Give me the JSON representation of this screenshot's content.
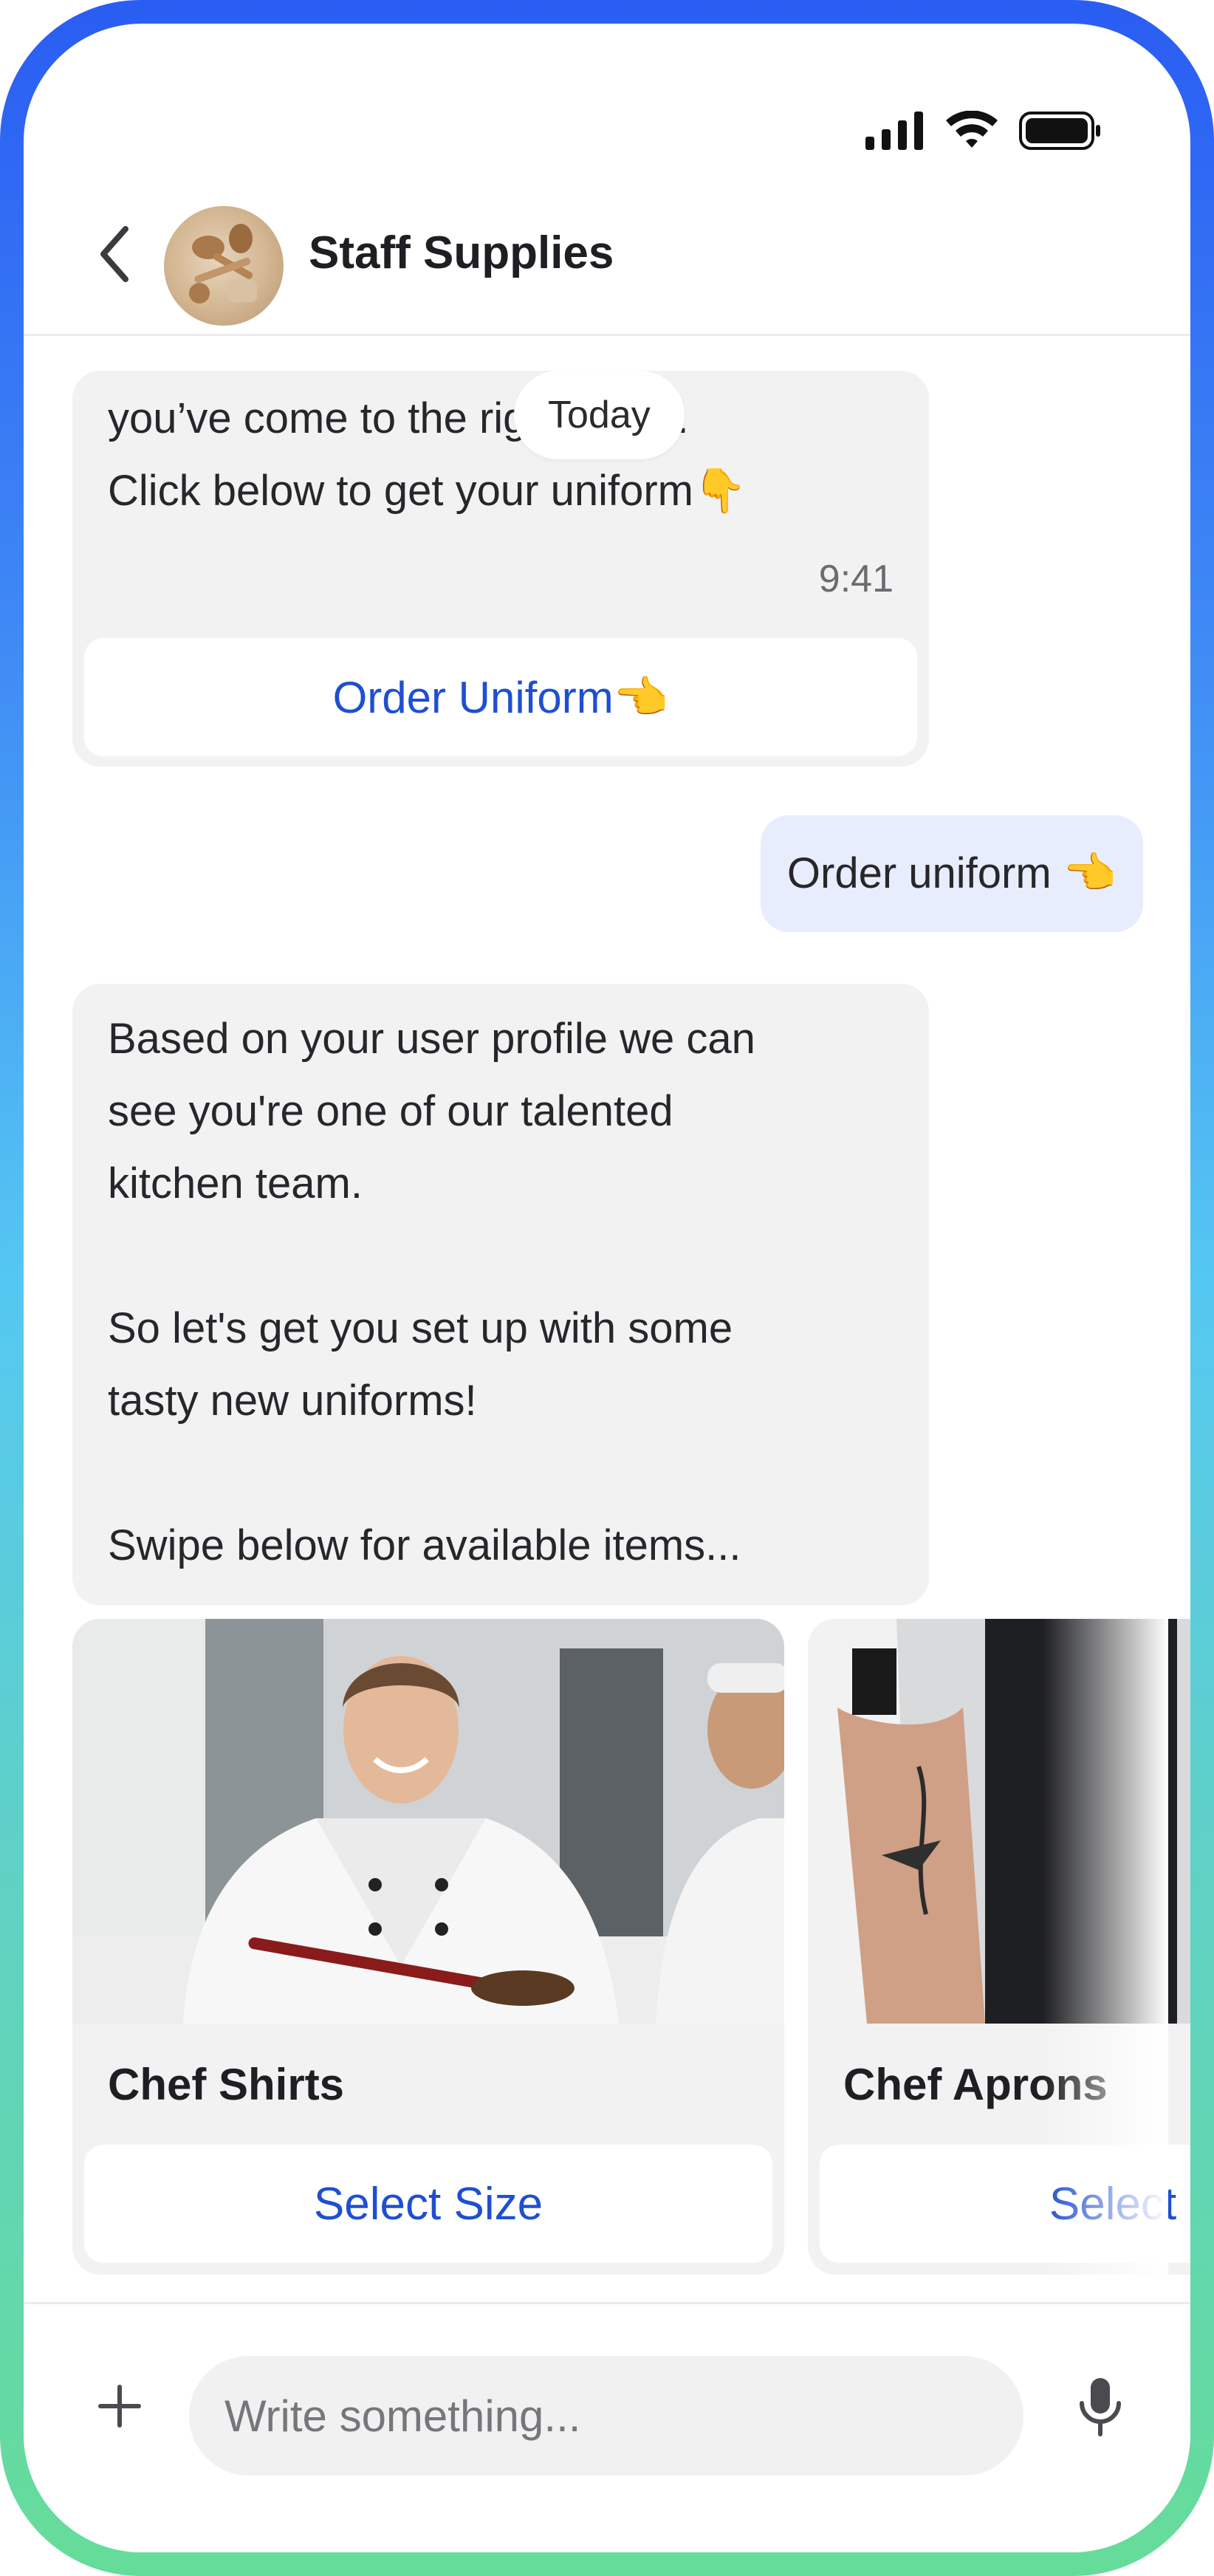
{
  "header": {
    "title": "Staff Supplies"
  },
  "chat": {
    "date_separator": "Today",
    "messages": [
      {
        "text": "you’ve come to the right place.\nClick below to get your uniform👇",
        "time": "9:41",
        "action_label": "Order Uniform👈"
      },
      {
        "text": "Order uniform 👈"
      },
      {
        "text": "Based on your user profile we can\nsee you're one of our talented\nkitchen team.\n\nSo let's get you set up with some\ntasty new uniforms!\n\nSwipe below for available items..."
      }
    ],
    "cards": [
      {
        "title": "Chef Shirts",
        "button": "Select Size"
      },
      {
        "title": "Chef Aprons",
        "button": "Select Size"
      }
    ]
  },
  "composer": {
    "placeholder": "Write something..."
  },
  "colors": {
    "accent": "#1f4fd1",
    "incoming_bubble": "#f2f2f3",
    "outgoing_bubble": "#e7edfd"
  }
}
